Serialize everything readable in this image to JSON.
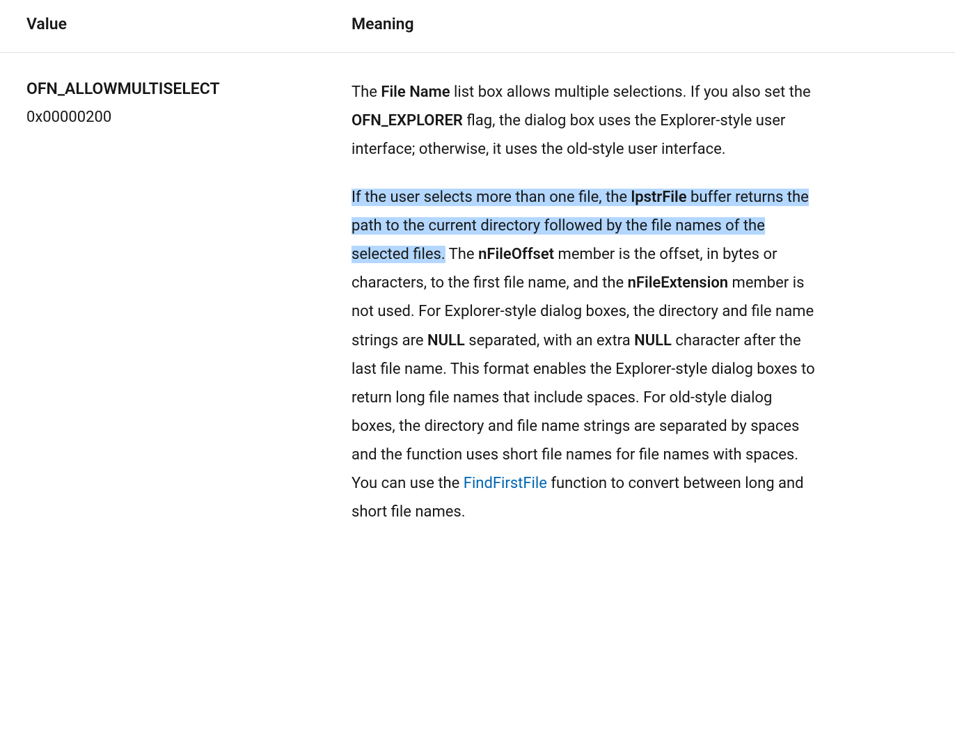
{
  "table": {
    "headers": {
      "value": "Value",
      "meaning": "Meaning"
    },
    "row": {
      "flag_name": "OFN_ALLOWMULTISELECT",
      "flag_hex": "0x00000200",
      "p1": {
        "t1": "The ",
        "b1": "File Name",
        "t2": " list box allows multiple selections. If you also set the ",
        "b2": "OFN_EXPLORER",
        "t3": " flag, the dialog box uses the Explorer-style user interface; otherwise, it uses the old-style user interface."
      },
      "p2": {
        "hl1": "If the user selects more than one file, the ",
        "hlb1": "lpstrFile",
        "hl2": " buffer returns the path to the current directory followed by the file names of the selected files.",
        "t1": " The ",
        "b1": "nFileOffset",
        "t2": " member is the offset, in bytes or characters, to the first file name, and the ",
        "b2": "nFileExtension",
        "t3": " member is not used. For Explorer-style dialog boxes, the directory and file name strings are ",
        "b3": "NULL",
        "t4": " separated, with an extra ",
        "b4": "NULL",
        "t5": " character after the last file name. This format enables the Explorer-style dialog boxes to return long file names that include spaces. For old-style dialog boxes, the directory and file name strings are separated by spaces and the function uses short file names for file names with spaces. You can use the ",
        "link1": "FindFirstFile",
        "t6": " function to convert between long and short file names."
      }
    }
  }
}
